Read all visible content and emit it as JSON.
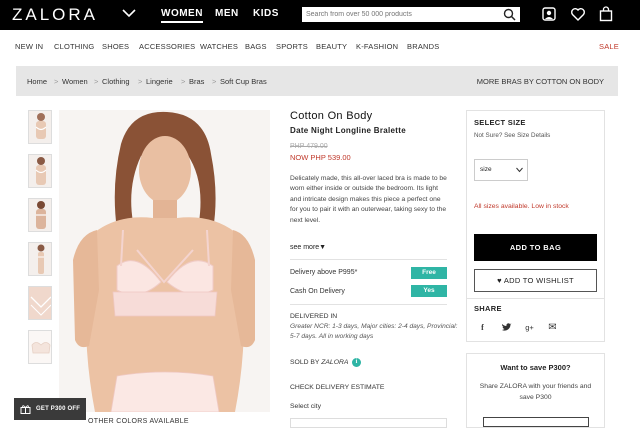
{
  "header": {
    "logo": "ZALORA",
    "genders": [
      "WOMEN",
      "MEN",
      "KIDS"
    ],
    "search_placeholder": "Search from over 50 000 products"
  },
  "categories": [
    "NEW IN",
    "CLOTHING",
    "SHOES",
    "ACCESSORIES",
    "WATCHES",
    "BAGS",
    "SPORTS",
    "BEAUTY",
    "K-FASHION",
    "BRANDS",
    "SALE"
  ],
  "breadcrumb": {
    "items": [
      "Home",
      "Women",
      "Clothing",
      "Lingerie",
      "Bras",
      "Soft Cup Bras"
    ],
    "right_link": "MORE BRAS BY COTTON ON BODY"
  },
  "product": {
    "brand": "Cotton On Body",
    "name": "Date Night Longline Bralette",
    "old_price": "PHP 479.00",
    "new_price": "NOW PHP 539.00",
    "description": "Delicately made, this all-over laced bra is made to be worn either inside or outside the bedroom. Its light and intricate design makes this piece a perfect one for you to pair it with an outerwear, taking sexy to the next level.",
    "see_more": "see more▼",
    "delivery_label": "Delivery above P995*",
    "delivery_badge": "Free",
    "cod_label": "Cash On Delivery",
    "cod_badge": "Yes",
    "delivered_in_title": "DELIVERED IN",
    "delivered_in_text": "Greater NCR: 1-3 days, Major cities: 2-4 days, Provincial: 5-7 days. All in working days",
    "sold_by_prefix": "SOLD BY",
    "sold_by_name": "ZALORA",
    "check_delivery": "CHECK DELIVERY ESTIMATE",
    "select_city": "Select city"
  },
  "size_panel": {
    "title": "SELECT SIZE",
    "not_sure": "Not Sure?",
    "size_details": "See Size Details",
    "select_value": "size",
    "availability": "All sizes available. Low in stock",
    "add_to_bag": "ADD TO BAG",
    "add_to_wishlist": "ADD TO WISHLIST",
    "share_title": "SHARE",
    "share_icons": [
      "f",
      "➔",
      "g+",
      "✉"
    ]
  },
  "promo": {
    "title": "Want to save P300?",
    "text": "Share ZALORA with your friends and save P300"
  },
  "floating": {
    "get_off": "GET P300 OFF",
    "other_colors": "OTHER COLORS AVAILABLE"
  },
  "colors": {
    "accent_teal": "#2fb5a5",
    "sale_red": "#c0392b",
    "black": "#000000"
  }
}
